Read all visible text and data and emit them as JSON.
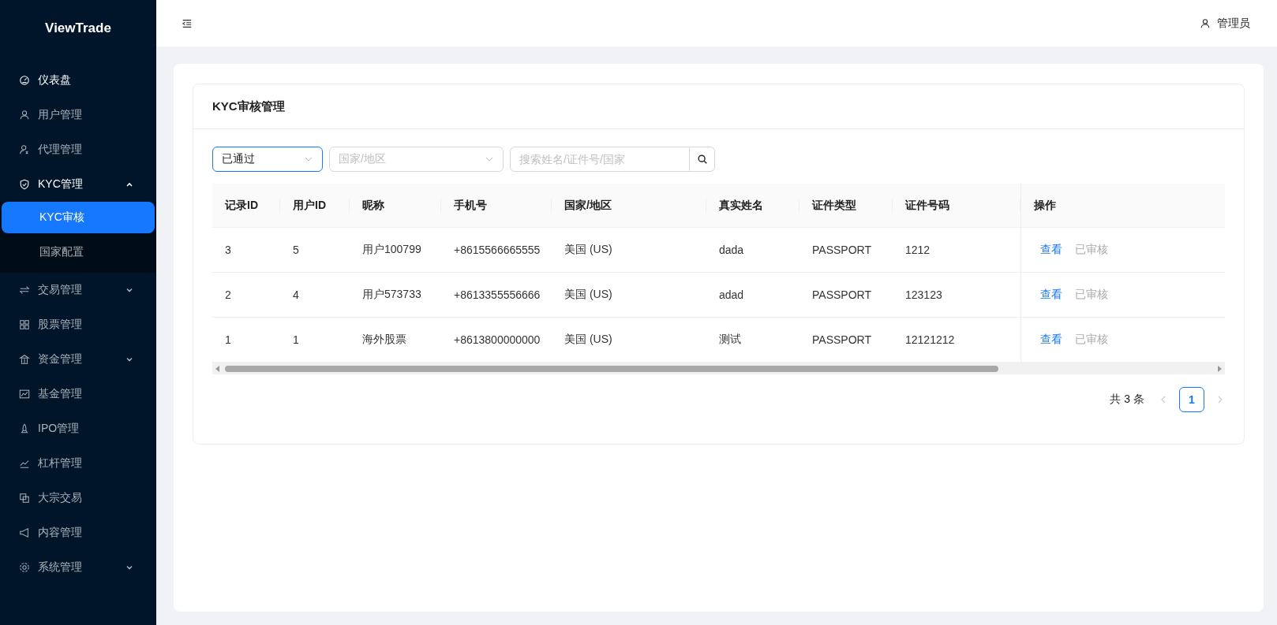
{
  "sidebar": {
    "logo": "ViewTrade",
    "items": [
      {
        "label": "仪表盘",
        "kind": "link",
        "active": true
      },
      {
        "label": "用户管理",
        "kind": "link",
        "active": false
      },
      {
        "label": "代理管理",
        "kind": "link",
        "active": false
      },
      {
        "label": "KYC管理",
        "kind": "group",
        "expanded": true,
        "active": true,
        "children": [
          {
            "label": "KYC审核",
            "selected": true
          },
          {
            "label": "国家配置",
            "selected": false
          }
        ]
      },
      {
        "label": "交易管理",
        "kind": "group",
        "expanded": false,
        "active": false
      },
      {
        "label": "股票管理",
        "kind": "link",
        "active": false
      },
      {
        "label": "资金管理",
        "kind": "group",
        "expanded": false,
        "active": false
      },
      {
        "label": "基金管理",
        "kind": "link",
        "active": false
      },
      {
        "label": "IPO管理",
        "kind": "link",
        "active": false
      },
      {
        "label": "杠杆管理",
        "kind": "link",
        "active": false
      },
      {
        "label": "大宗交易",
        "kind": "link",
        "active": false
      },
      {
        "label": "内容管理",
        "kind": "link",
        "active": false
      },
      {
        "label": "系统管理",
        "kind": "group",
        "expanded": false,
        "active": false
      }
    ]
  },
  "header": {
    "user": "管理员"
  },
  "panel": {
    "title": "KYC审核管理",
    "filters": {
      "status": {
        "value": "已通过"
      },
      "country": {
        "placeholder": "国家/地区"
      },
      "search": {
        "placeholder": "搜索姓名/证件号/国家"
      }
    },
    "table": {
      "columns": [
        "记录ID",
        "用户ID",
        "昵称",
        "手机号",
        "国家/地区",
        "真实姓名",
        "证件类型",
        "证件号码",
        "操作"
      ],
      "rows": [
        {
          "cells": [
            "3",
            "5",
            "用户100799",
            "+8615566665555",
            "美国 (US)",
            "dada",
            "PASSPORT",
            "1212"
          ],
          "view": "查看",
          "status": "已审核"
        },
        {
          "cells": [
            "2",
            "4",
            "用户573733",
            "+8613355556666",
            "美国 (US)",
            "adad",
            "PASSPORT",
            "123123"
          ],
          "view": "查看",
          "status": "已审核"
        },
        {
          "cells": [
            "1",
            "1",
            "海外股票",
            "+8613800000000",
            "美国 (US)",
            "测试",
            "PASSPORT",
            "12121212"
          ],
          "view": "查看",
          "status": "已审核"
        }
      ]
    },
    "pagination": {
      "total": "共 3 条",
      "pages": [
        {
          "label": "1",
          "selected": true
        }
      ],
      "prev_disabled": true,
      "next_disabled": true
    }
  }
}
